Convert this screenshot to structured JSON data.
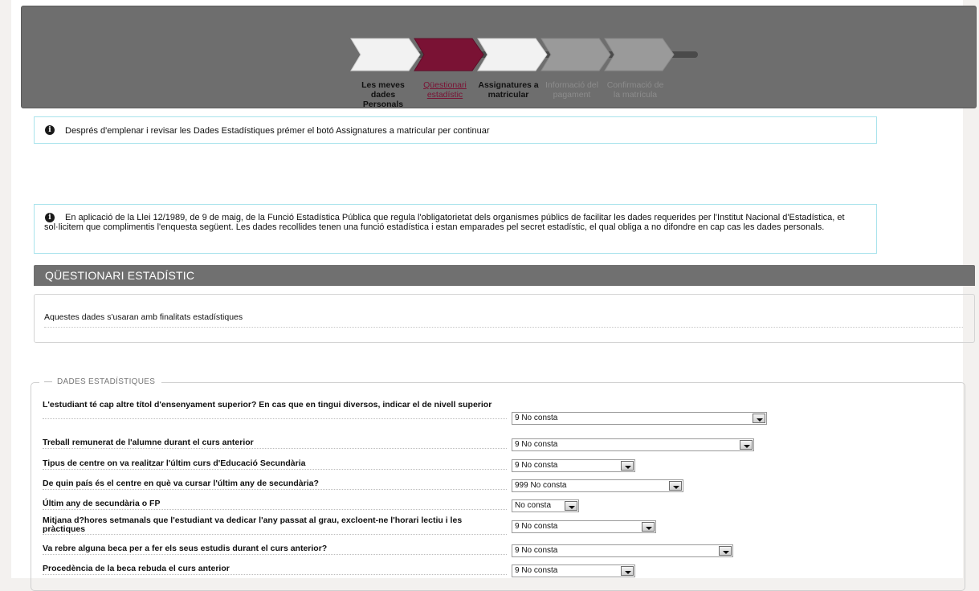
{
  "wizard": {
    "steps": [
      {
        "label": "Les meves dades\nPersonals",
        "state": "done"
      },
      {
        "label": "Qüestionari\nestadístic",
        "state": "active"
      },
      {
        "label": "Assignatures a\nmatricular",
        "state": "done"
      },
      {
        "label": "Informació del\npagament",
        "state": "disabled"
      },
      {
        "label": "Confirmació de\nla matrícula",
        "state": "disabled"
      }
    ],
    "colors": {
      "active": "#7a1234",
      "done": "#f2f2f2",
      "disabled": "#9a9a9a"
    }
  },
  "notices": {
    "first": "Després d'emplenar i revisar les Dades Estadístiques prémer el botó Assignatures a matricular per continuar",
    "second": "En aplicació de la Llei 12/1989, de 9 de maig, de la Funció Estadística Pública que regula l'obligatorietat dels organismes públics de facilitar les dades requerides per l'Institut Nacional d'Estadística, et sol·licitem que complimentis l'enquesta següent. Les dades recollides tenen una funció estadística i estan emparades pel secret estadístic, el qual obliga a no difondre en cap cas les dades personals."
  },
  "section": {
    "title": "QÜESTIONARI ESTADÍSTIC",
    "description": "Aquestes dades s'usaran amb finalitats estadístiques"
  },
  "fieldset": {
    "legend": "DADES ESTADÍSTIQUES",
    "questions": [
      {
        "label": "L'estudiant té cap altre títol d'ensenyament superior? En cas que en tingui diversos, indicar el de nivell superior",
        "value": "9 No consta"
      },
      {
        "label": "Treball remunerat de l'alumne durant el curs anterior",
        "value": "9 No consta"
      },
      {
        "label": "Tipus de centre on va realitzar l'últim curs d'Educació Secundària",
        "value": "9 No consta"
      },
      {
        "label": "De quin país és el centre en què va cursar l'últim any de secundària?",
        "value": "999 No consta"
      },
      {
        "label": "Últim any de secundària o FP",
        "value": "No consta"
      },
      {
        "label": "Mitjana d?hores setmanals que l'estudiant va dedicar l'any passat al grau, excloent-ne l'horari lectiu i les pràctiques",
        "value": "9 No consta"
      },
      {
        "label": "Va rebre alguna beca per a fer els seus estudis durant el curs anterior?",
        "value": "9 No consta"
      },
      {
        "label": "Procedència de la beca rebuda el curs anterior",
        "value": "9 No consta"
      }
    ]
  },
  "icons": {
    "info": "info-circle-icon",
    "dropdown": "dropdown-arrow-icon"
  }
}
